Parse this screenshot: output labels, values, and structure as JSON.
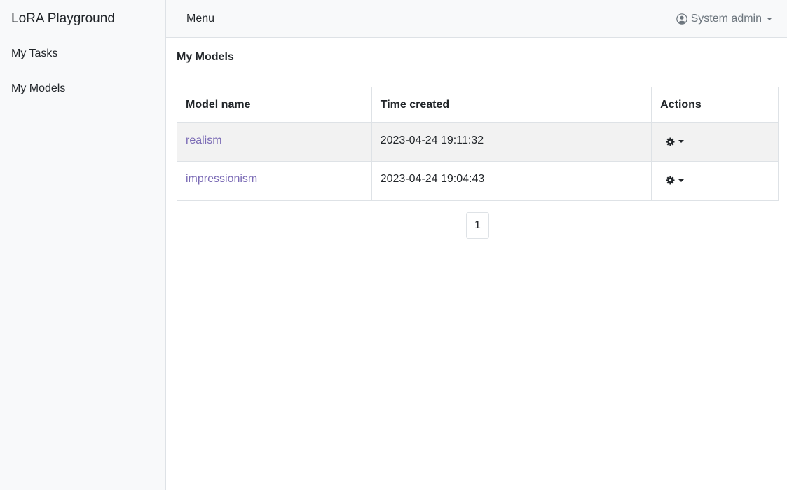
{
  "app": {
    "brand": "LoRA Playground"
  },
  "sidebar": {
    "items": [
      {
        "label": "My Tasks"
      },
      {
        "label": "My Models"
      }
    ]
  },
  "topbar": {
    "menu_label": "Menu",
    "user_label": "System admin",
    "user_icon": "user-circle-icon"
  },
  "main": {
    "title": "My Models",
    "table": {
      "headers": [
        "Model name",
        "Time created",
        "Actions"
      ],
      "rows": [
        {
          "name": "realism",
          "created": "2023-04-24 19:11:32",
          "action_icon": "gear-icon"
        },
        {
          "name": "impressionism",
          "created": "2023-04-24 19:04:43",
          "action_icon": "gear-icon"
        }
      ]
    },
    "pagination": {
      "current_page": "1"
    }
  },
  "colors": {
    "sidebar_bg": "#f8f9fa",
    "link": "#7a6ab5",
    "border": "#dee2e6",
    "striped_row": "#f2f2f2"
  }
}
